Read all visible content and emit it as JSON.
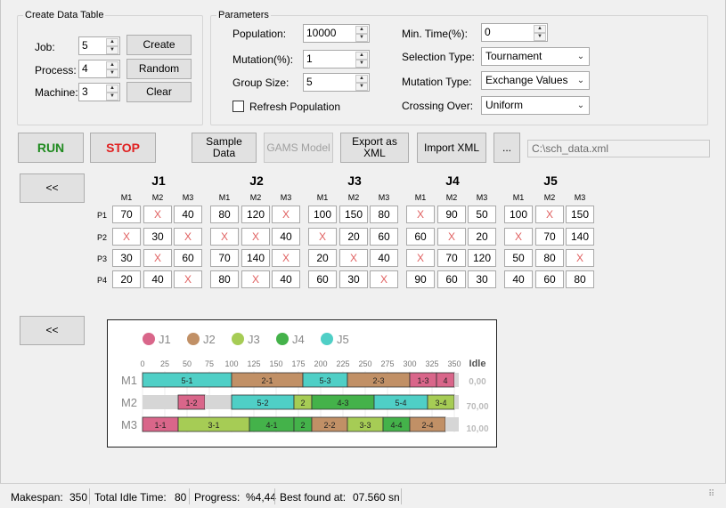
{
  "create_table": {
    "title": "Create Data Table",
    "job_label": "Job:",
    "job_value": "5",
    "process_label": "Process:",
    "process_value": "4",
    "machine_label": "Machine:",
    "machine_value": "3",
    "create_btn": "Create",
    "random_btn": "Random",
    "clear_btn": "Clear"
  },
  "parameters": {
    "title": "Parameters",
    "population_label": "Population:",
    "population_value": "10000",
    "mutation_label": "Mutation(%):",
    "mutation_value": "1",
    "group_size_label": "Group Size:",
    "group_size_value": "5",
    "refresh_label": "Refresh Population",
    "min_time_label": "Min. Time(%):",
    "min_time_value": "0",
    "selection_label": "Selection Type:",
    "selection_value": "Tournament",
    "mutation_type_label": "Mutation Type:",
    "mutation_type_value": "Exchange Values",
    "crossing_label": "Crossing Over:",
    "crossing_value": "Uniform"
  },
  "toolbar": {
    "run": "RUN",
    "stop": "STOP",
    "sample_line1": "Sample",
    "sample_line2": "Data",
    "gams": "GAMS Model",
    "export_line1": "Export as",
    "export_line2": "XML",
    "import": "Import XML",
    "browse": "...",
    "path": "C:\\sch_data.xml",
    "collapse1": "<<",
    "collapse2": "<<"
  },
  "data_table": {
    "jobs": [
      "J1",
      "J2",
      "J3",
      "J4",
      "J5"
    ],
    "machines": [
      "M1",
      "M2",
      "M3"
    ],
    "processes": [
      "P1",
      "P2",
      "P3",
      "P4"
    ],
    "values": [
      [
        [
          "70",
          "X",
          "40"
        ],
        [
          "X",
          "30",
          "X"
        ],
        [
          "30",
          "X",
          "60"
        ],
        [
          "20",
          "40",
          "X"
        ]
      ],
      [
        [
          "80",
          "120",
          "X"
        ],
        [
          "X",
          "X",
          "40"
        ],
        [
          "70",
          "140",
          "X"
        ],
        [
          "80",
          "X",
          "40"
        ]
      ],
      [
        [
          "100",
          "150",
          "80"
        ],
        [
          "X",
          "20",
          "60"
        ],
        [
          "20",
          "X",
          "40"
        ],
        [
          "60",
          "30",
          "X"
        ]
      ],
      [
        [
          "X",
          "90",
          "50"
        ],
        [
          "60",
          "X",
          "20"
        ],
        [
          "X",
          "70",
          "120"
        ],
        [
          "90",
          "60",
          "30"
        ]
      ],
      [
        [
          "100",
          "X",
          "150"
        ],
        [
          "X",
          "70",
          "140"
        ],
        [
          "50",
          "80",
          "X"
        ],
        [
          "40",
          "60",
          "80"
        ]
      ]
    ]
  },
  "gantt": {
    "legend": [
      {
        "name": "J1",
        "color": "#d9668a"
      },
      {
        "name": "J2",
        "color": "#c19066"
      },
      {
        "name": "J3",
        "color": "#a6cc55"
      },
      {
        "name": "J4",
        "color": "#44b24a"
      },
      {
        "name": "J5",
        "color": "#4fcfc6"
      }
    ],
    "ticks": [
      "0",
      "25",
      "50",
      "75",
      "100",
      "125",
      "150",
      "175",
      "200",
      "225",
      "250",
      "275",
      "300",
      "325",
      "350"
    ],
    "idle_header": "Idle",
    "max": 350,
    "rows": [
      {
        "machine": "M1",
        "idle": "0,00",
        "blocks": [
          {
            "label": "5-1",
            "start": 0,
            "end": 100,
            "job": 4
          },
          {
            "label": "2-1",
            "start": 100,
            "end": 180,
            "job": 1
          },
          {
            "label": "5-3",
            "start": 180,
            "end": 230,
            "job": 4
          },
          {
            "label": "2-3",
            "start": 230,
            "end": 300,
            "job": 1
          },
          {
            "label": "1-3",
            "start": 300,
            "end": 330,
            "job": 0
          },
          {
            "label": "4",
            "start": 330,
            "end": 350,
            "job": 0
          }
        ]
      },
      {
        "machine": "M2",
        "idle": "70,00",
        "blocks": [
          {
            "label": "",
            "start": 0,
            "end": 40,
            "job": -1
          },
          {
            "label": "1-2",
            "start": 40,
            "end": 70,
            "job": 0
          },
          {
            "label": "",
            "start": 70,
            "end": 100,
            "job": -1
          },
          {
            "label": "5-2",
            "start": 100,
            "end": 170,
            "job": 4
          },
          {
            "label": "2",
            "start": 170,
            "end": 190,
            "job": 2
          },
          {
            "label": "4-3",
            "start": 190,
            "end": 260,
            "job": 3
          },
          {
            "label": "5-4",
            "start": 260,
            "end": 320,
            "job": 4
          },
          {
            "label": "3-4",
            "start": 320,
            "end": 350,
            "job": 2
          }
        ]
      },
      {
        "machine": "M3",
        "idle": "10,00",
        "blocks": [
          {
            "label": "1-1",
            "start": 0,
            "end": 40,
            "job": 0
          },
          {
            "label": "3-1",
            "start": 40,
            "end": 120,
            "job": 2
          },
          {
            "label": "4-1",
            "start": 120,
            "end": 170,
            "job": 3
          },
          {
            "label": "2",
            "start": 170,
            "end": 190,
            "job": 3
          },
          {
            "label": "2-2",
            "start": 190,
            "end": 230,
            "job": 1
          },
          {
            "label": "3-3",
            "start": 230,
            "end": 270,
            "job": 2
          },
          {
            "label": "4-4",
            "start": 270,
            "end": 300,
            "job": 3
          },
          {
            "label": "2-4",
            "start": 300,
            "end": 340,
            "job": 1
          },
          {
            "label": "",
            "start": 340,
            "end": 350,
            "job": -1
          }
        ]
      }
    ]
  },
  "status": {
    "makespan_label": "Makespan:",
    "makespan": "350",
    "idle_label": "Total Idle Time:",
    "idle": "80",
    "progress_label": "Progress:",
    "progress": "%4,44",
    "best_label": "Best found at:",
    "best": "07.560 sn"
  }
}
